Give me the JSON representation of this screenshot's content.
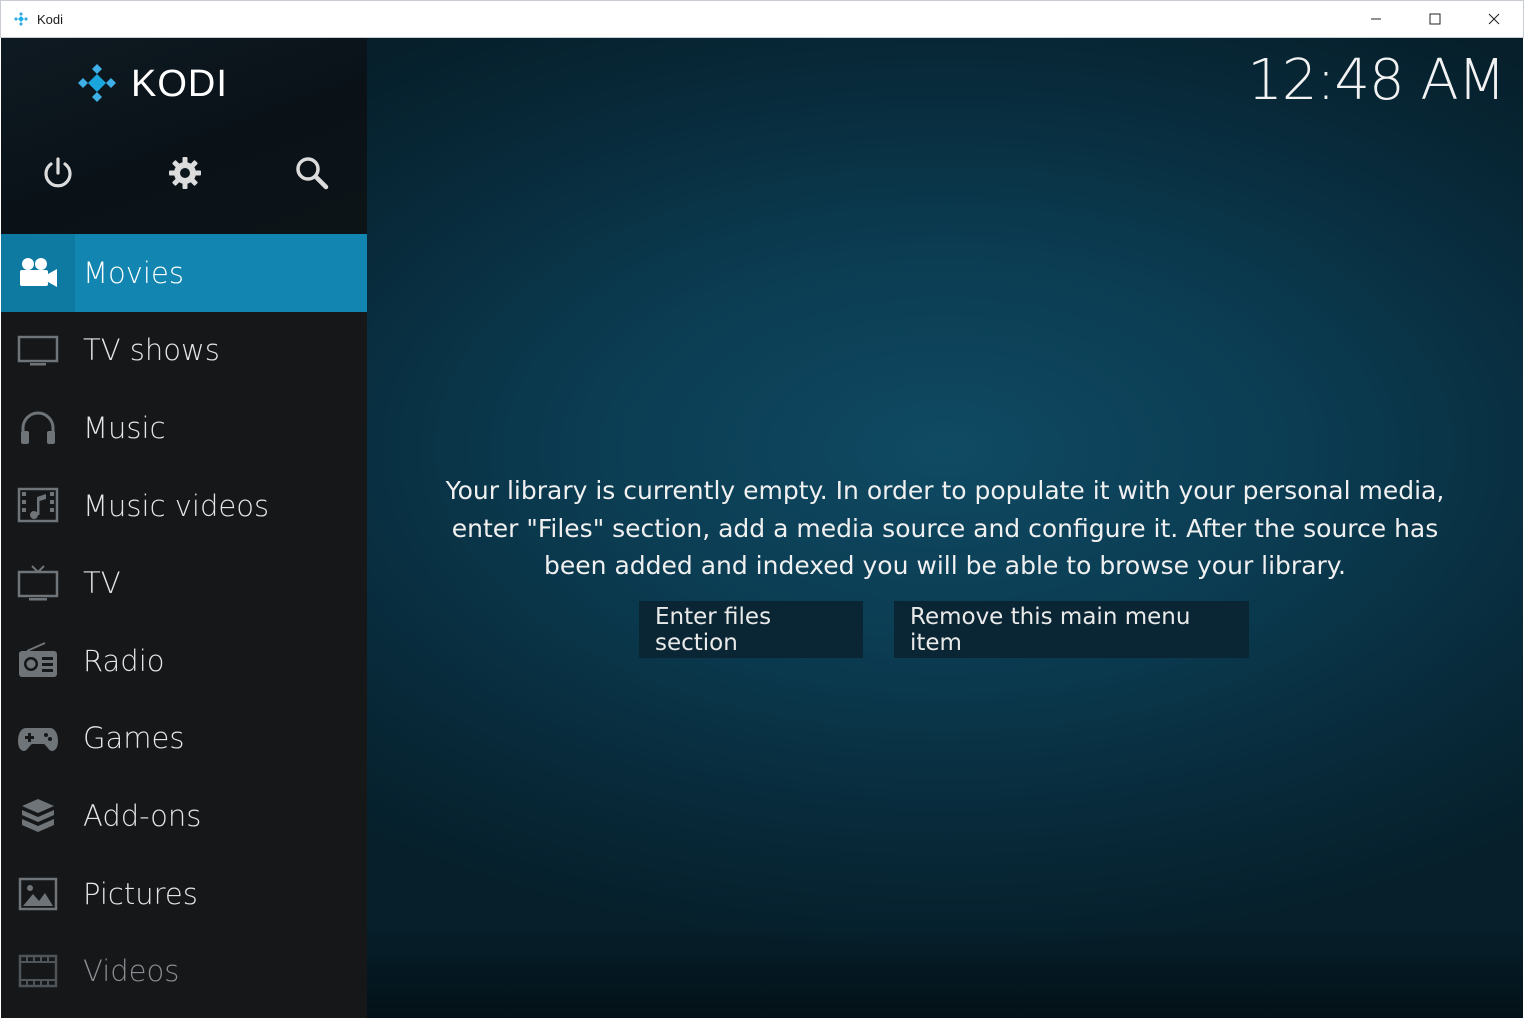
{
  "window": {
    "title": "Kodi",
    "controls": [
      "minimize-icon",
      "maximize-icon",
      "close-icon"
    ]
  },
  "header": {
    "logo_text": "KODI",
    "clock": "12:48 AM",
    "top_icons": [
      "power-icon",
      "gear-icon",
      "search-icon"
    ]
  },
  "sidebar": {
    "items": [
      {
        "label": "Movies",
        "icon": "movie-camera-icon",
        "active": true
      },
      {
        "label": "TV shows",
        "icon": "tv-monitor-icon"
      },
      {
        "label": "Music",
        "icon": "headphones-icon"
      },
      {
        "label": "Music videos",
        "icon": "music-video-icon"
      },
      {
        "label": "TV",
        "icon": "tv-icon"
      },
      {
        "label": "Radio",
        "icon": "radio-icon"
      },
      {
        "label": "Games",
        "icon": "gamepad-icon"
      },
      {
        "label": "Add-ons",
        "icon": "addons-box-icon"
      },
      {
        "label": "Pictures",
        "icon": "picture-icon"
      },
      {
        "label": "Videos",
        "icon": "film-strip-icon"
      }
    ]
  },
  "main": {
    "message": "Your library is currently empty. In order to populate it with your personal media, enter \"Files\" section, add a media source and configure it. After the source has been added and indexed you will be able to browse your library.",
    "enter_files_label": "Enter files section",
    "remove_item_label": "Remove this main menu item"
  },
  "colors": {
    "accent": "#1286b0",
    "sidebar_bg": "#151719",
    "background": "#0b3c52",
    "button_bg": "#0a2533"
  }
}
